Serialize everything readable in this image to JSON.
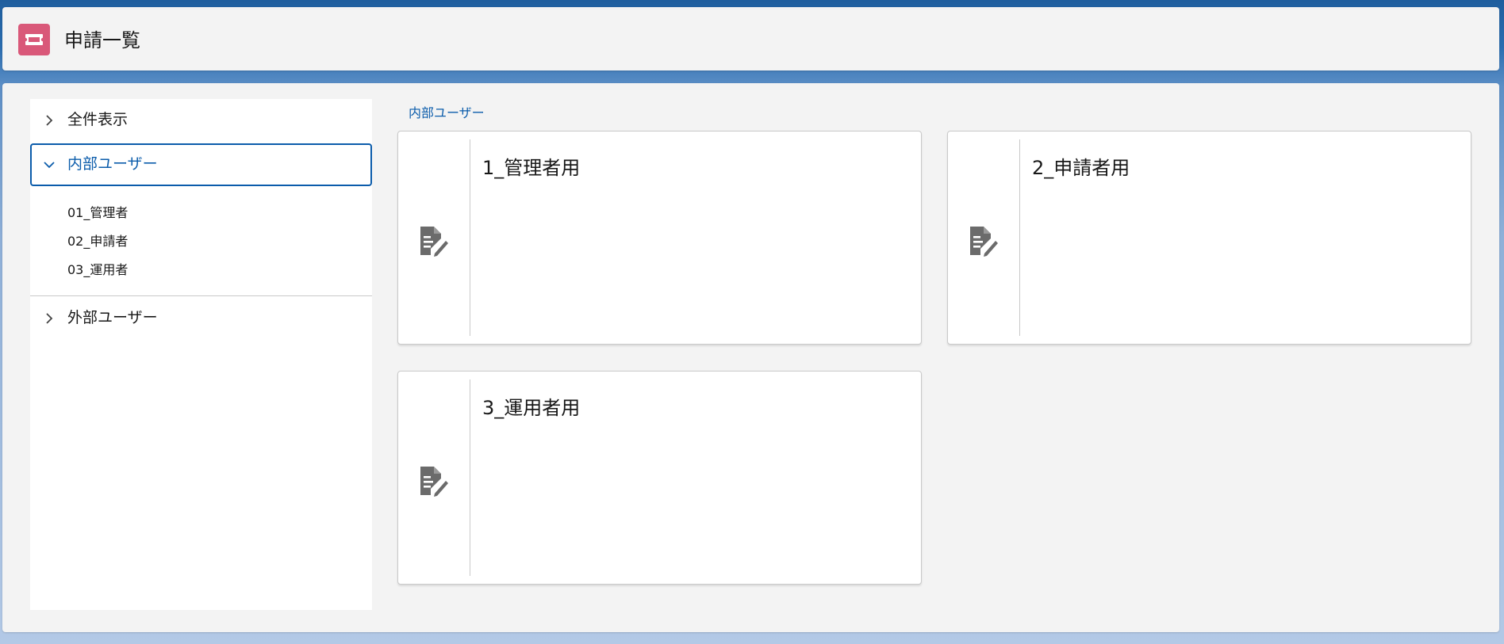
{
  "header": {
    "title": "申請一覧",
    "icon": "ticket-icon",
    "icon_color": "#d95879"
  },
  "nav": {
    "items": [
      {
        "label": "全件表示",
        "expanded": false,
        "icon": "chevron-right-icon"
      },
      {
        "label": "内部ユーザー",
        "expanded": true,
        "icon": "chevron-down-icon",
        "children": [
          "01_管理者",
          "02_申請者",
          "03_運用者"
        ]
      },
      {
        "label": "外部ユーザー",
        "expanded": false,
        "icon": "chevron-right-icon"
      }
    ]
  },
  "breadcrumb": {
    "label": "内部ユーザー"
  },
  "cards": [
    {
      "title": "1_管理者用",
      "icon": "document-edit-icon"
    },
    {
      "title": "2_申請者用",
      "icon": "document-edit-icon"
    },
    {
      "title": "3_運用者用",
      "icon": "document-edit-icon"
    }
  ],
  "colors": {
    "accent": "#0b5cab",
    "background_blue": "#2a6db0",
    "panel": "#f3f3f3"
  }
}
